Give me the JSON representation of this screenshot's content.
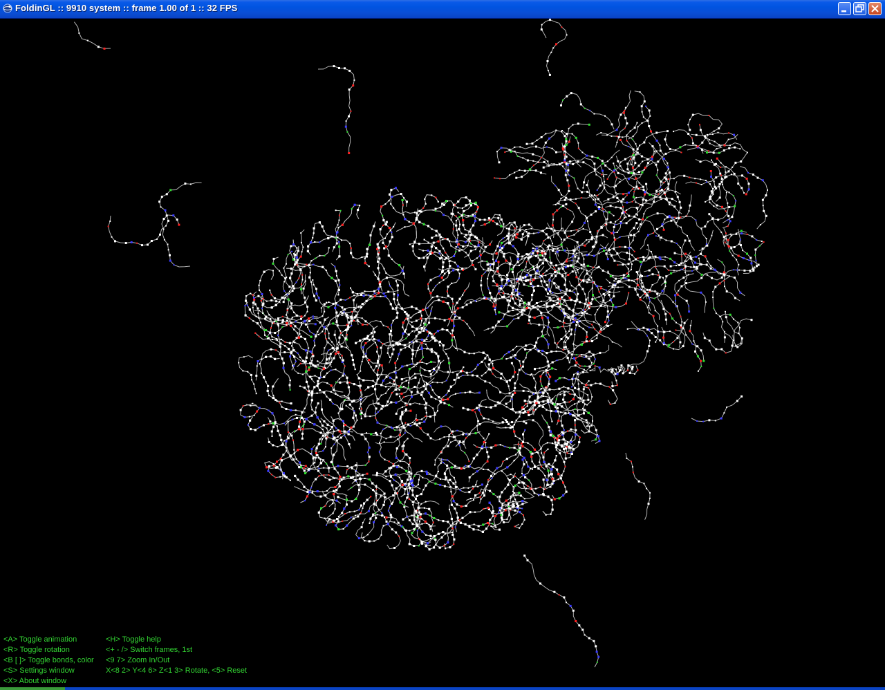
{
  "window": {
    "title": "FoldinGL :: 9910 system :: frame 1.00 of 1 :: 32 FPS",
    "icon": "foldingl-app-icon",
    "buttons": [
      {
        "name": "minimize",
        "icon": "minimize-icon"
      },
      {
        "name": "restore",
        "icon": "restore-icon"
      },
      {
        "name": "close",
        "icon": "close-icon"
      }
    ]
  },
  "viewport": {
    "background": "#000000",
    "bond_color": "#b4b4b4",
    "atom_colors": {
      "carbon": "#ffffff",
      "oxygen": "#ff2020",
      "nitrogen": "#3a3aff",
      "sulfur": "#30e030"
    }
  },
  "help": {
    "left": [
      "<A> Toggle animation",
      "<R> Toggle rotation",
      "<B [ ]> Toggle bonds, color",
      "<S> Settings window",
      "<X> About window"
    ],
    "right": [
      "<H> Toggle help",
      "<+ - /> Switch frames, 1st",
      "<9 7> Zoom In/Out",
      "X<8 2> Y<4 6> Z<1 3> Rotate, <5> Reset"
    ],
    "color": "#33d633"
  }
}
